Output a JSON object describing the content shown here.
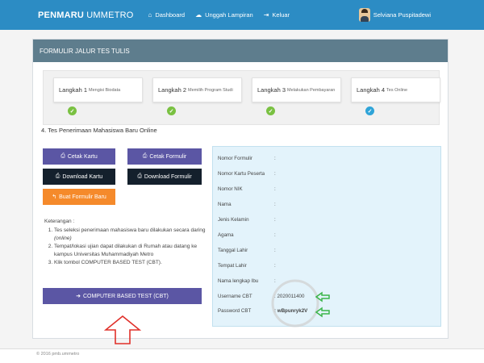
{
  "nav": {
    "brand_bold": "PENMARU",
    "brand_thin": "UMMETRO",
    "items": [
      {
        "label": "Dashboard",
        "icon": "home-icon"
      },
      {
        "label": "Unggah Lampiran",
        "icon": "upload-cloud-icon"
      },
      {
        "label": "Keluar",
        "icon": "logout-icon"
      }
    ],
    "user_name": "Selviana Puspitadewi"
  },
  "panel": {
    "title": "FORMULIR JALUR TES TULIS"
  },
  "steps": [
    {
      "big": "Langkah 1",
      "small": "Mengisi Biodata",
      "status": "done"
    },
    {
      "big": "Langkah 2",
      "small": "Memilih Program Studi",
      "status": "done"
    },
    {
      "big": "Langkah 3",
      "small": "Melakukan Pembayaran",
      "status": "done"
    },
    {
      "big": "Langkah 4",
      "small": "Tes Online",
      "status": "current"
    }
  ],
  "section_title": "4. Tes Penerimaan Mahasiswa Baru Online",
  "buttons": {
    "cetak_kartu": "Cetak Kartu",
    "cetak_formulir": "Cetak Formulir",
    "download_kartu": "Download Kartu",
    "download_formulir": "Download Formulir",
    "buat_formulir": "Buat Formulir Baru",
    "cbt": "COMPUTER BASED TEST (CBT)"
  },
  "keterangan": {
    "title": "Keterangan :",
    "items": [
      {
        "text": "Tes seleksi penerimaan mahasiswa baru dilakukan secara daring",
        "italic": "(online)"
      },
      {
        "text": "Tempat/lokasi ujian dapat dilakukan di Rumah atau datang ke kampus Universitas Muhammadiyah Metro"
      },
      {
        "text": "Klik tombol COMPUTER BASED TEST (CBT)."
      }
    ]
  },
  "info": {
    "rows": [
      {
        "label": "Nomor Formulir",
        "value": ":"
      },
      {
        "label": "Nomor Kartu Peserta",
        "value": ":"
      },
      {
        "label": "Nomor NIK",
        "value": ":"
      },
      {
        "label": "Nama",
        "value": ":"
      },
      {
        "label": "Jenis Kelamin",
        "value": ":"
      },
      {
        "label": "Agama",
        "value": ":"
      },
      {
        "label": "Tanggal Lahir",
        "value": ":"
      },
      {
        "label": "Tempat Lahir",
        "value": ":"
      },
      {
        "label": "Nama lengkap Ibu",
        "value": ":"
      },
      {
        "label": "Username CBT",
        "value": ": 2020011400"
      },
      {
        "label": "Password CBT",
        "value": ": wBpunryk2V"
      }
    ]
  },
  "footer": {
    "copy": "© 2016 pmb.ummetro"
  },
  "colors": {
    "nav": "#2c8cc4",
    "panel_head": "#5e7d8d",
    "purple": "#5b56a4",
    "dark": "#14202c",
    "orange": "#f58a2b",
    "step_done": "#7ac142",
    "step_current": "#2fa4d8",
    "annotation_arrow_green": "#3bb54a",
    "annotation_arrow_red": "#e0302a"
  }
}
